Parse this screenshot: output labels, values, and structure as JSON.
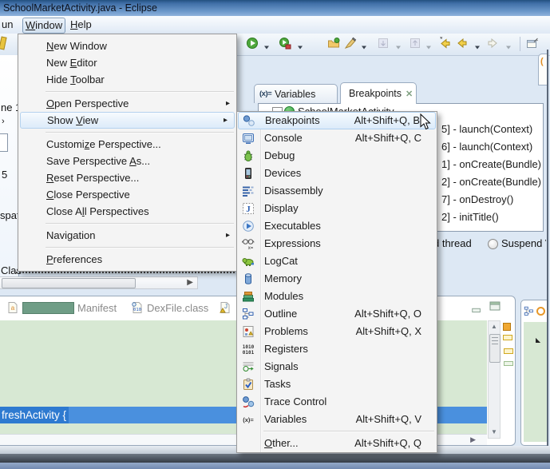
{
  "window": {
    "title": "SchoolMarketActivity.java - Eclipse"
  },
  "menubar": {
    "items": [
      {
        "label": "un",
        "pressed": false
      },
      {
        "label": "&Window",
        "pressed": true
      },
      {
        "label": "&Help",
        "pressed": false
      }
    ]
  },
  "toolbar": {
    "icons": [
      {
        "name": "run-button",
        "glyph": "run"
      },
      {
        "name": "run-dropdown",
        "glyph": "dropdown"
      },
      {
        "name": "coverage-run-button",
        "glyph": "run-coverage"
      },
      {
        "name": "coverage-run-dropdown",
        "glyph": "dropdown"
      },
      {
        "name": "open-type-button",
        "glyph": "open-folder"
      },
      {
        "name": "format-button",
        "glyph": "brush"
      },
      {
        "name": "format-dropdown",
        "glyph": "dropdown"
      },
      {
        "name": "save-button-disabled",
        "glyph": "save-gray"
      },
      {
        "name": "save-dropdown-disabled",
        "glyph": "dropdown-gray"
      },
      {
        "name": "navigate-up-button-disabled",
        "glyph": "up-gray"
      },
      {
        "name": "navigate-up-dropdown-disabled",
        "glyph": "dropdown-gray"
      },
      {
        "name": "last-edit-location-button",
        "glyph": "back-star"
      },
      {
        "name": "back-button",
        "glyph": "back"
      },
      {
        "name": "back-dropdown",
        "glyph": "dropdown"
      },
      {
        "name": "forward-button-disabled",
        "glyph": "forward"
      },
      {
        "name": "forward-dropdown-disabled",
        "glyph": "dropdown-gray"
      },
      {
        "name": "toolbar-separator",
        "glyph": "separator"
      },
      {
        "name": "pin-editor-button",
        "glyph": "pin"
      }
    ]
  },
  "window_menu": {
    "items": [
      {
        "label": "&New Window"
      },
      {
        "label": "New &Editor"
      },
      {
        "label": "Hide &Toolbar"
      },
      {
        "type": "separator"
      },
      {
        "label": "&Open Perspective",
        "submenu": true
      },
      {
        "label": "Show &View",
        "submenu": true,
        "highlighted": true
      },
      {
        "type": "separator"
      },
      {
        "label": "Customi&ze Perspective..."
      },
      {
        "label": "Save Perspective &As..."
      },
      {
        "label": "&Reset Perspective..."
      },
      {
        "label": "&Close Perspective"
      },
      {
        "label": "Close A&ll Perspectives"
      },
      {
        "type": "separator"
      },
      {
        "label": "Navi&gation",
        "submenu": true
      },
      {
        "type": "separator"
      },
      {
        "label": "&Preferences"
      }
    ]
  },
  "show_view_submenu": {
    "items": [
      {
        "label": "Breakpoints",
        "icon": "breakpoints",
        "shortcut": "Alt+Shift+Q, B",
        "highlighted": true
      },
      {
        "label": "Console",
        "icon": "console",
        "shortcut": "Alt+Shift+Q, C"
      },
      {
        "label": "Debug",
        "icon": "debug"
      },
      {
        "label": "Devices",
        "icon": "devices"
      },
      {
        "label": "Disassembly",
        "icon": "disassembly"
      },
      {
        "label": "Display",
        "icon": "display"
      },
      {
        "label": "Executables",
        "icon": "executables"
      },
      {
        "label": "Expressions",
        "icon": "expressions"
      },
      {
        "label": "LogCat",
        "icon": "logcat"
      },
      {
        "label": "Memory",
        "icon": "memory"
      },
      {
        "label": "Modules",
        "icon": "modules"
      },
      {
        "label": "Outline",
        "icon": "outline",
        "shortcut": "Alt+Shift+Q, O"
      },
      {
        "label": "Problems",
        "icon": "problems",
        "shortcut": "Alt+Shift+Q, X"
      },
      {
        "label": "Registers",
        "icon": "registers"
      },
      {
        "label": "Signals",
        "icon": "signals"
      },
      {
        "label": "Tasks",
        "icon": "tasks"
      },
      {
        "label": "Trace Control",
        "icon": "trace-control"
      },
      {
        "label": "Variables",
        "icon": "variables",
        "shortcut": "Alt+Shift+Q, V"
      },
      {
        "type": "separator"
      },
      {
        "label": "&Other...",
        "shortcut": "Alt+Shift+Q, Q"
      }
    ]
  },
  "breakpoints_panel": {
    "tabs": [
      {
        "label": "Variables",
        "icon": "variables",
        "active": false
      },
      {
        "label": "Breakpoints",
        "icon": "breakpoints",
        "active": true,
        "closable": true
      }
    ],
    "tree_root": "SchoolMarketActivity",
    "entries": [
      "5] - launch(Context)",
      "6] - launch(Context)",
      "1] - onCreate(Bundle)",
      "2] - onCreate(Bundle)",
      "7] - onDestroy()",
      "2] - initTitle()"
    ],
    "suspend_thread_label": "d thread",
    "suspend_vm_label": "Suspend V"
  },
  "editor": {
    "tabs": [
      {
        "label": "Manifest",
        "icon": "manifest",
        "redacted_prefix": true
      },
      {
        "label": "DexFile.class",
        "icon": "dexfile"
      },
      {
        "label": "",
        "icon": "file-warning"
      }
    ],
    "selected_line": "freshActivity {"
  },
  "fragments": {
    "text_1": "ne 1",
    "arrow": "›",
    "text_2": "5",
    "text_3": "spat",
    "text_4": "Clas"
  },
  "colors": {
    "titlebar_blue": "#3f6ea6",
    "editor_green": "#d7e8d3",
    "selection_blue": "#2e7ad0",
    "menu_bg": "#f4f4f4",
    "highlight_border": "#aecfef"
  }
}
